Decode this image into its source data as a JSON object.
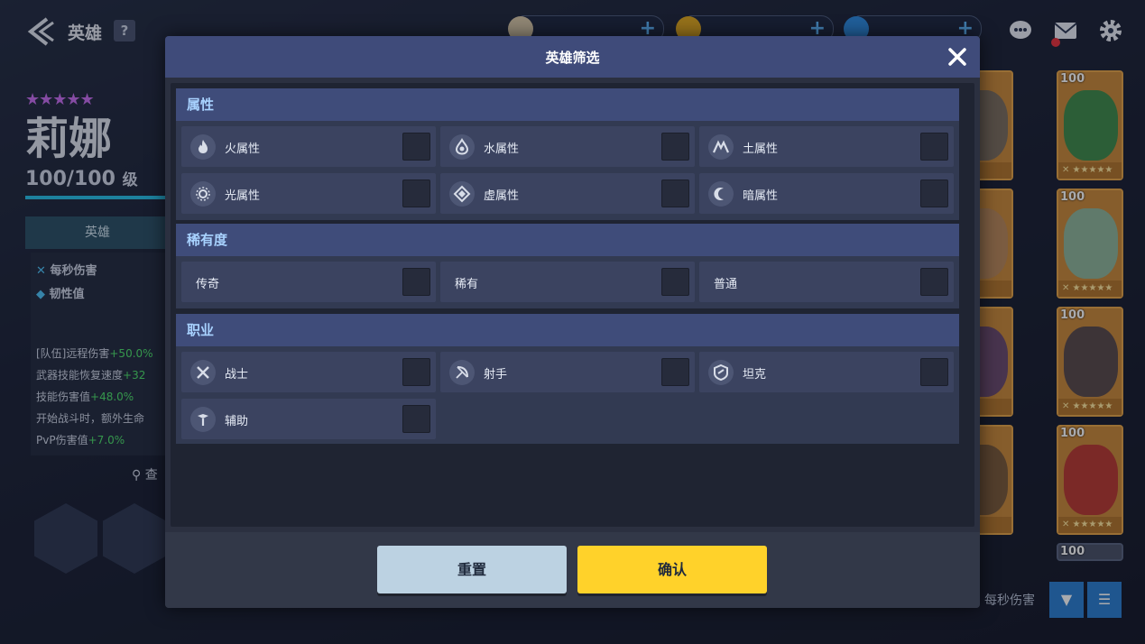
{
  "header": {
    "title": "英雄",
    "help": "?"
  },
  "hero": {
    "stars": "★★★★★",
    "name": "莉娜",
    "level": "100/100",
    "level_unit": "级",
    "tab": "英雄",
    "stat_dps": "每秒伤害",
    "stat_toughness": "韧性值",
    "buffs": [
      {
        "label": "[队伍]远程伤害",
        "value": "+50.0%"
      },
      {
        "label": "武器技能恢复速度",
        "value": "+32"
      },
      {
        "label": "技能伤害值",
        "value": "+48.0%"
      },
      {
        "label": "开始战斗时，额外生命",
        "value": ""
      },
      {
        "label": "PvP伤害值",
        "value": "+7.0%"
      }
    ],
    "search_hint": "查"
  },
  "roster": {
    "levels": [
      "100",
      "100",
      "100",
      "100",
      "100"
    ],
    "sort_label": "每秒伤害"
  },
  "modal": {
    "title": "英雄筛选",
    "sections": {
      "attribute": {
        "title": "属性",
        "options": [
          "火属性",
          "水属性",
          "土属性",
          "光属性",
          "虚属性",
          "暗属性"
        ]
      },
      "rarity": {
        "title": "稀有度",
        "options": [
          "传奇",
          "稀有",
          "普通"
        ]
      },
      "class": {
        "title": "职业",
        "options": [
          "战士",
          "射手",
          "坦克",
          "辅助"
        ]
      }
    },
    "reset_label": "重置",
    "confirm_label": "确认"
  },
  "colors": {
    "header_bar": "#3f4b7a",
    "section_title": "#a8d2ff",
    "confirm": "#ffd22a",
    "reset": "#bcd2e2"
  }
}
